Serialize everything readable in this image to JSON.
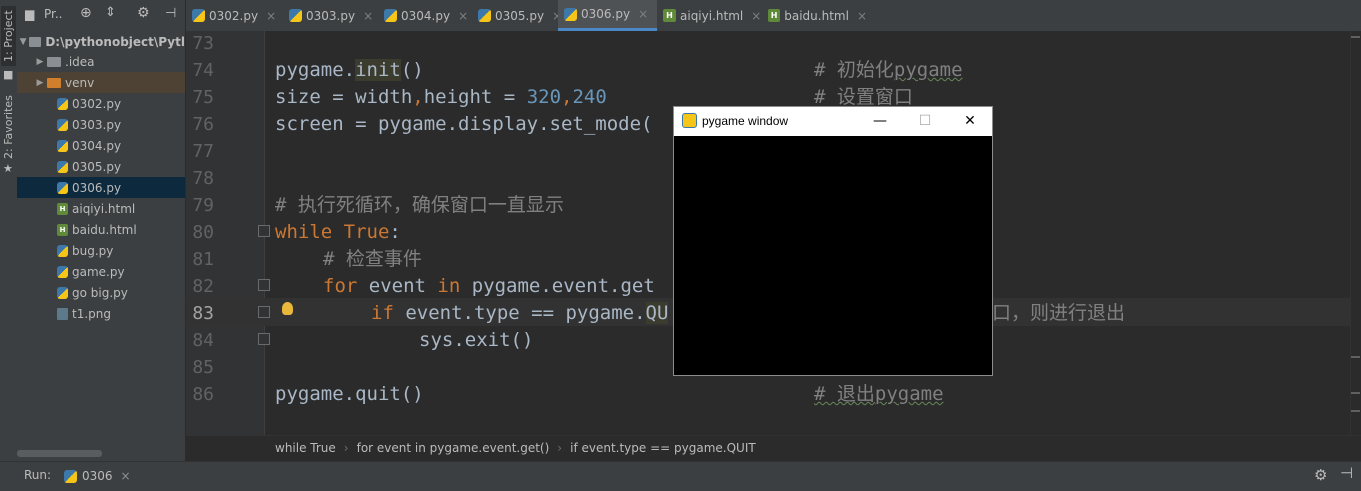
{
  "toolstrip": {
    "project_tab": "1: Project",
    "favorites_tab": "2: Favorites"
  },
  "project_header": {
    "label": "Pr..",
    "icons": [
      "folder-icon",
      "crosshair-icon",
      "collapse-icon",
      "gear-icon",
      "hide-icon"
    ]
  },
  "tabs": [
    {
      "label": "0302.py",
      "type": "py"
    },
    {
      "label": "0303.py",
      "type": "py"
    },
    {
      "label": "0304.py",
      "type": "py"
    },
    {
      "label": "0305.py",
      "type": "py"
    },
    {
      "label": "0306.py",
      "type": "py",
      "active": true
    },
    {
      "label": "aiqiyi.html",
      "type": "html"
    },
    {
      "label": "baidu.html",
      "type": "html"
    }
  ],
  "tree": {
    "root": "D:\\pythonobject\\Pytl",
    "items": [
      {
        "label": ".idea",
        "kind": "folder"
      },
      {
        "label": "venv",
        "kind": "folder"
      },
      {
        "label": "0302.py",
        "kind": "py"
      },
      {
        "label": "0303.py",
        "kind": "py"
      },
      {
        "label": "0304.py",
        "kind": "py"
      },
      {
        "label": "0305.py",
        "kind": "py"
      },
      {
        "label": "0306.py",
        "kind": "py",
        "selected": true
      },
      {
        "label": "aiqiyi.html",
        "kind": "html"
      },
      {
        "label": "baidu.html",
        "kind": "html"
      },
      {
        "label": "bug.py",
        "kind": "py"
      },
      {
        "label": "game.py",
        "kind": "py"
      },
      {
        "label": "go big.py",
        "kind": "py"
      },
      {
        "label": "t1.png",
        "kind": "png"
      }
    ]
  },
  "editor": {
    "line_numbers": [
      "73",
      "74",
      "75",
      "76",
      "77",
      "78",
      "79",
      "80",
      "81",
      "82",
      "83",
      "84",
      "85",
      "86"
    ],
    "current_line": "83",
    "lines": {
      "l74_a": "pygame.",
      "l74_b": "init",
      "l74_c": "()",
      "l74_cm_a": "# 初始化",
      "l74_cm_b": "pygame",
      "l75_a": "size = width",
      "l75_b": ",",
      "l75_c": "height = ",
      "l75_n1": "320",
      "l75_d": ",",
      "l75_n2": "240",
      "l75_cm": "# 设置窗口",
      "l76": "screen = pygame.display.set_mode(",
      "l79_cm": "# 执行死循环，确保窗口一直显示",
      "l80_kw": "while ",
      "l80_kw2": "True",
      "l80_b": ":",
      "l81_cm": "# 检查事件",
      "l82_kw": "for ",
      "l82_b": "event ",
      "l82_kw2": "in ",
      "l82_c": "pygame.event.get",
      "l83_kw": "if ",
      "l83_b": "event.type == pygame.",
      "l83_c": "QU",
      "l83_cm": "口，则进行退出",
      "l84": "sys.exit()",
      "l86": "pygame.quit()",
      "l86_cm_a": "# 退出",
      "l86_cm_b": "pygame"
    }
  },
  "breadcrumb": [
    "while True",
    "for event in pygame.event.get()",
    "if event.type == pygame.QUIT"
  ],
  "runbar": {
    "label": "Run:",
    "tab": "0306",
    "close": "×"
  },
  "pygame_window": {
    "title": "pygame window",
    "minimize": "—",
    "maximize": "☐",
    "close": "✕"
  },
  "colors": {
    "keyword": "#cc7832",
    "number": "#6897bb",
    "comment": "#808080",
    "accent": "#4a88c7"
  }
}
